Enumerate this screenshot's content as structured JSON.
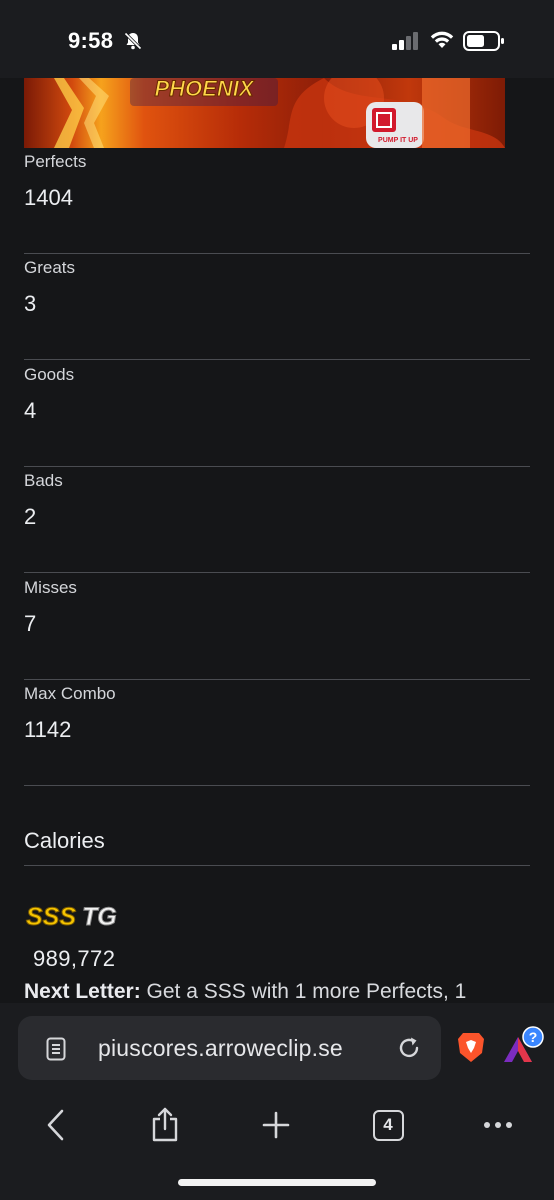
{
  "status_bar": {
    "time": "9:58",
    "icons": [
      "bell-slash-icon",
      "cellular-signal-icon",
      "wifi-icon",
      "battery-icon"
    ]
  },
  "banner": {
    "logo_text": "PHOENIX",
    "badge_text": "PUMP IT UP",
    "colors": {
      "start": "#7a1a06",
      "mid": "#e0530f",
      "end": "#7e1b05"
    }
  },
  "stats": [
    {
      "label": "Perfects",
      "value": "1404"
    },
    {
      "label": "Greats",
      "value": "3"
    },
    {
      "label": "Goods",
      "value": "4"
    },
    {
      "label": "Bads",
      "value": "2"
    },
    {
      "label": "Misses",
      "value": "7"
    },
    {
      "label": "Max Combo",
      "value": "1142"
    }
  ],
  "calories": {
    "title": "Calories"
  },
  "grade": {
    "badge_text": "SSS",
    "plate_text": "TG",
    "icon": "grade-sss-plus-badge-icon"
  },
  "score": {
    "value": "989,772"
  },
  "next_letter": {
    "label": "Next Letter:",
    "text": "Get a SSS with 1 more Perfects, 1"
  },
  "browser": {
    "url": "piuscores.arroweclip.se",
    "tab_count": "4",
    "rewards_badge": "?",
    "icons": [
      "page-icon",
      "reload-icon",
      "brave-lion-icon",
      "brave-rewards-icon",
      "back-icon",
      "share-icon",
      "new-tab-icon",
      "tabs-icon",
      "more-icon"
    ]
  },
  "colors": {
    "background": "#151618",
    "chrome": "#1b1c1f",
    "divider": "#4a4c51",
    "url_bar": "#2a2b2f",
    "brave_orange": "#fb542b",
    "grade_gold": "#f5c400"
  }
}
